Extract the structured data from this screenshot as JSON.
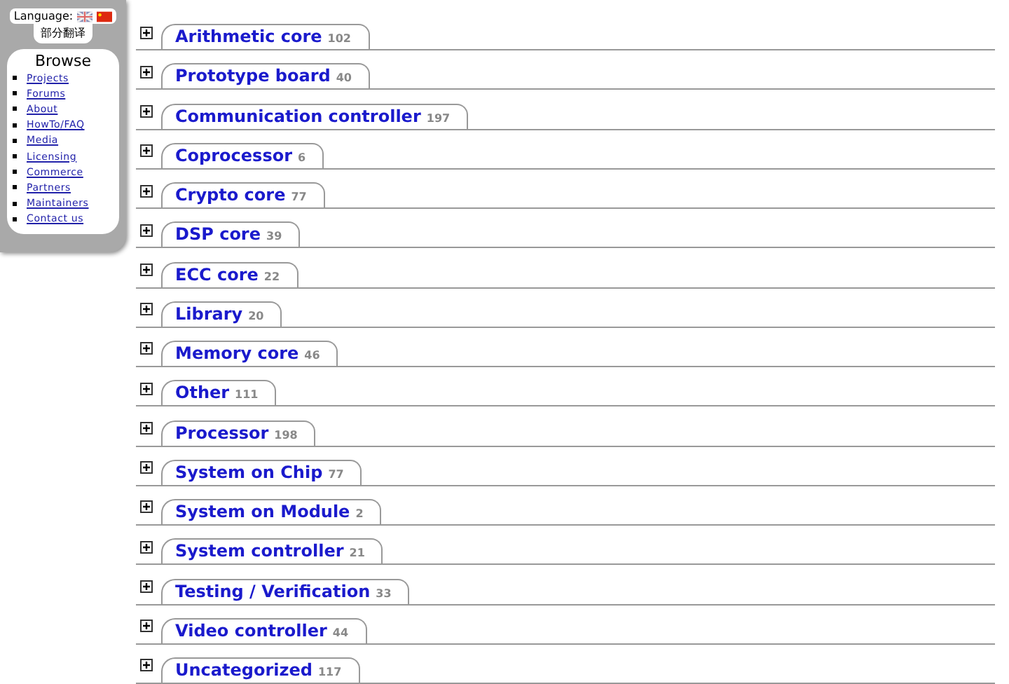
{
  "language": {
    "label": "Language:",
    "translate_button": "部分翻译"
  },
  "browse": {
    "title": "Browse",
    "links": [
      "Projects",
      "Forums",
      "About",
      "HowTo/FAQ",
      "Media",
      "Licensing",
      "Commerce",
      "Partners",
      "Maintainers",
      "Contact us"
    ]
  },
  "categories": [
    {
      "name": "Arithmetic core",
      "count": "102",
      "expanded": false
    },
    {
      "name": "Prototype board",
      "count": "40",
      "expanded": false
    },
    {
      "name": "Communication controller",
      "count": "197",
      "expanded": false
    },
    {
      "name": "Coprocessor",
      "count": "6",
      "expanded": false
    },
    {
      "name": "Crypto core",
      "count": "77",
      "expanded": false
    },
    {
      "name": "DSP core",
      "count": "39",
      "expanded": false
    },
    {
      "name": "ECC core",
      "count": "22",
      "expanded": false
    },
    {
      "name": "Library",
      "count": "20",
      "expanded": false
    },
    {
      "name": "Memory core",
      "count": "46",
      "expanded": false
    },
    {
      "name": "Other",
      "count": "111",
      "expanded": false
    },
    {
      "name": "Processor",
      "count": "198",
      "expanded": false
    },
    {
      "name": "System on Chip",
      "count": "77",
      "expanded": false
    },
    {
      "name": "System on Module",
      "count": "2",
      "expanded": false
    },
    {
      "name": "System controller",
      "count": "21",
      "expanded": false
    },
    {
      "name": "Testing / Verification",
      "count": "33",
      "expanded": false
    },
    {
      "name": "Video controller",
      "count": "44",
      "expanded": false
    },
    {
      "name": "Uncategorized",
      "count": "117",
      "expanded": false
    }
  ]
}
